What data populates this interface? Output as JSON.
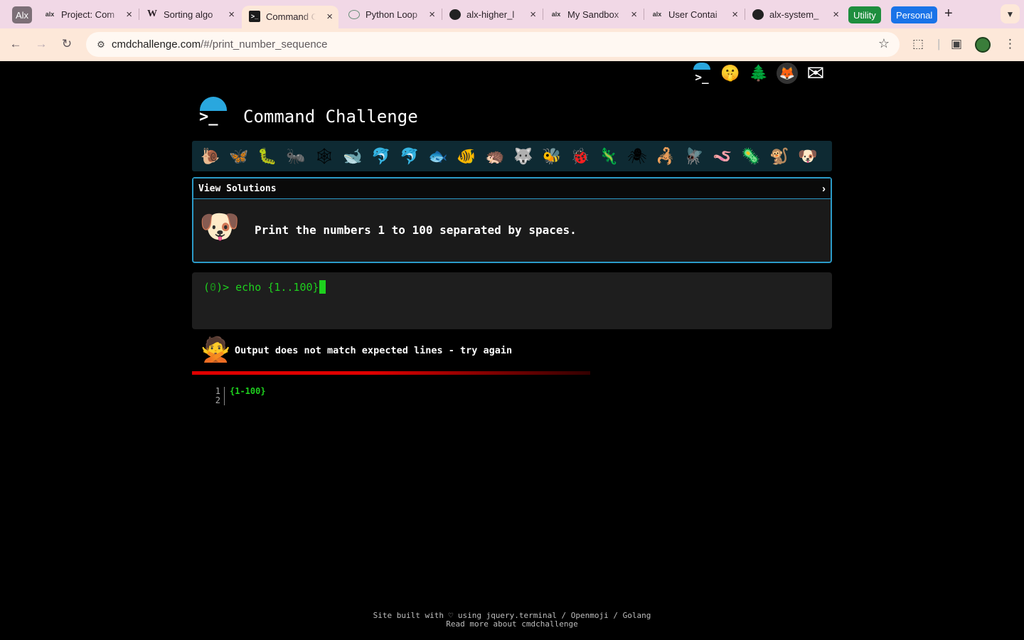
{
  "browser": {
    "profile_chip": "Alx",
    "tabs": [
      {
        "favicon": "alx-icon",
        "title": "Project: Com"
      },
      {
        "favicon": "wikipedia-icon",
        "title": "Sorting algo"
      },
      {
        "favicon": "terminal-icon",
        "title": "Command C"
      },
      {
        "favicon": "chatgpt-icon",
        "title": "Python Loop"
      },
      {
        "favicon": "github-icon",
        "title": "alx-higher_l"
      },
      {
        "favicon": "alx-icon",
        "title": "My Sandbox"
      },
      {
        "favicon": "alx-icon",
        "title": "User Contai"
      },
      {
        "favicon": "github-icon",
        "title": "alx-system_"
      }
    ],
    "active_tab_index": 2,
    "tab_groups": [
      {
        "label": "Utility",
        "color": "#1e8e3e"
      },
      {
        "label": "Personal",
        "color": "#1a73e8"
      }
    ],
    "new_tab": "+",
    "url": {
      "domain": "cmdchallenge.com",
      "path": "/#/print_number_sequence"
    }
  },
  "site": {
    "title": "Command Challenge",
    "top_icons": [
      "terminal-logo-icon",
      "shushing-face-icon",
      "evergreen-tree-icon",
      "gitlab-icon",
      "envelope-icon"
    ],
    "top_icon_glyphs": [
      "⌨",
      "🤫",
      "🌲",
      "🦊",
      "✉"
    ],
    "challenge_emojis": [
      "🐌",
      "🦋",
      "🐛",
      "🐜",
      "🕸",
      "🐋",
      "🐬",
      "🐬",
      "🐟",
      "🐠",
      "🦔",
      "🐺",
      "🐝",
      "🐞",
      "🦎",
      "🕷",
      "🦂",
      "🪰",
      "🪱",
      "🦠",
      "🐒",
      "🐶"
    ],
    "panel": {
      "header": "View Solutions",
      "chevron": "›",
      "emoji": "🐶",
      "description": "Print the numbers 1 to 100 separated by spaces."
    },
    "terminal": {
      "prompt_open": "(",
      "prompt_count": "0",
      "prompt_close": ")> ",
      "command": "echo {1..100}"
    },
    "result": {
      "emoji": "🙅",
      "message": "Output does not match expected lines - try again"
    },
    "output_lines": [
      {
        "num": "1",
        "text": "{1-100}"
      },
      {
        "num": "2",
        "text": ""
      }
    ],
    "footer": {
      "line1": "Site built with ♡ using jquery.terminal / Openmoji / Golang",
      "line2": "Read more about cmdchallenge"
    }
  }
}
